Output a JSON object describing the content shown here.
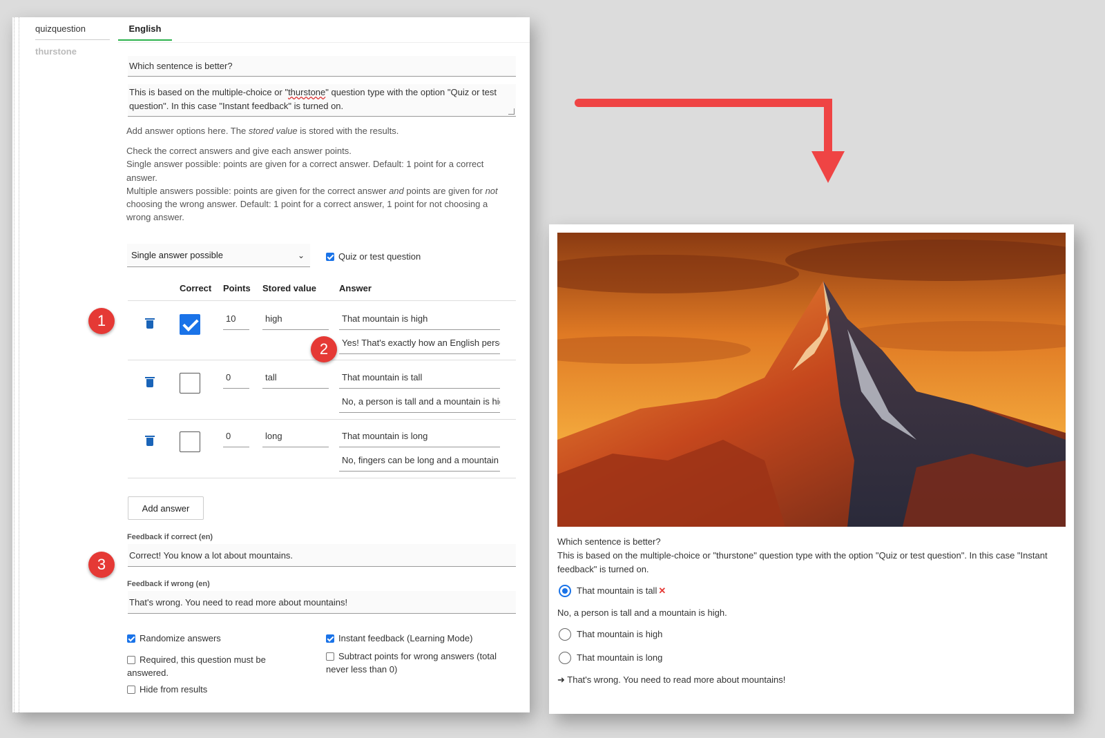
{
  "editor": {
    "side_tabs": [
      "quizquestion",
      "thurstone"
    ],
    "language_tab": "English",
    "question_title": "Which sentence is better?",
    "description_pre": "This is based on the multiple-choice or \"",
    "description_misspelled": "thurstone",
    "description_post": "\" question type with the option \"Quiz or test question\". In this case \"Instant feedback\" is turned on.",
    "help_options_pre": "Add answer options here. The ",
    "help_options_em": "stored value",
    "help_options_post": " is stored with the results.",
    "help_line1": "Check the correct answers and give each answer points.",
    "help_line2": "Single answer possible: points are given for a correct answer. Default: 1 point for a correct answer.",
    "help_line3_a": "Multiple answers possible: points are given for the correct answer ",
    "help_line3_em1": "and",
    "help_line3_b": " points are given for ",
    "help_line3_em2": "not",
    "help_line3_c": " choosing the wrong answer. Default: 1 point for a correct answer, 1 point for not choosing a wrong answer.",
    "answer_mode": "Single answer possible",
    "quiz_checkbox_label": "Quiz or test question",
    "quiz_checked": true,
    "columns": {
      "correct": "Correct",
      "points": "Points",
      "stored": "Stored value",
      "answer": "Answer"
    },
    "answers": [
      {
        "correct": true,
        "points": "10",
        "stored": "high",
        "answer": "That mountain is high",
        "feedback": "Yes! That's exactly how an English person would say it."
      },
      {
        "correct": false,
        "points": "0",
        "stored": "tall",
        "answer": "That mountain is tall",
        "feedback": "No, a person is tall and a mountain is high."
      },
      {
        "correct": false,
        "points": "0",
        "stored": "long",
        "answer": "That mountain is long",
        "feedback": "No, fingers can be long and a mountain is high."
      }
    ],
    "add_answer_label": "Add answer",
    "feedback_correct_label": "Feedback if correct (en)",
    "feedback_correct": "Correct! You know a lot about mountains.",
    "feedback_wrong_label": "Feedback if wrong (en)",
    "feedback_wrong": "That's wrong. You need to read more about mountains!",
    "options": {
      "randomize": {
        "label": "Randomize answers",
        "checked": true
      },
      "instant": {
        "label": "Instant feedback (Learning Mode)",
        "checked": true
      },
      "required": {
        "label": "Required, this question must be answered.",
        "checked": false
      },
      "subtract": {
        "label": "Subtract points for wrong answers (total never less than 0)",
        "checked": false
      },
      "hide": {
        "label": "Hide from results",
        "checked": false
      }
    }
  },
  "badges": [
    "1",
    "2",
    "3"
  ],
  "preview": {
    "question_title": "Which sentence is better?",
    "description": "This is based on the multiple-choice or \"thurstone\" question type with the option \"Quiz or test question\". In this case \"Instant feedback\" is turned on.",
    "selected_answer": "That mountain is tall",
    "selected_feedback": "No, a person is tall and a mountain is high.",
    "other_answers": [
      "That mountain is high",
      "That mountain is long"
    ],
    "result_message": "➜ That's wrong. You need to read more about mountains!",
    "wrong_mark": "✕"
  },
  "colors": {
    "accent": "#1a73e8",
    "badge": "#e53935",
    "arrow": "#ef4444",
    "tab_underline": "#2bb24c"
  }
}
